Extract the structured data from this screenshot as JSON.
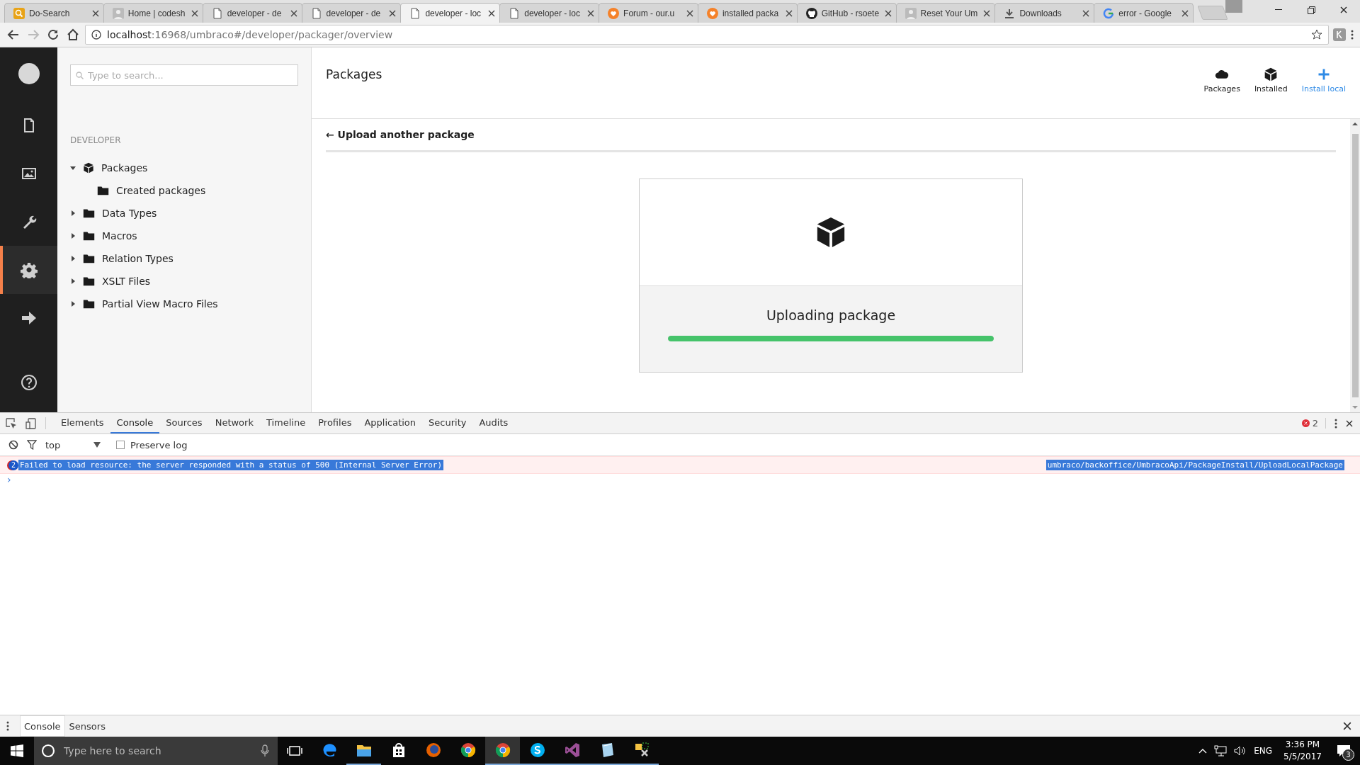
{
  "browser_tabs": [
    {
      "title": "Do-Search",
      "kind": "search",
      "selected": false
    },
    {
      "title": "Home | codesh",
      "kind": "avatar",
      "selected": false
    },
    {
      "title": "developer - de",
      "kind": "page",
      "selected": false
    },
    {
      "title": "developer - de",
      "kind": "page",
      "selected": false
    },
    {
      "title": "developer - loc",
      "kind": "page",
      "selected": true
    },
    {
      "title": "developer - loc",
      "kind": "page",
      "selected": false
    },
    {
      "title": "Forum - our.u",
      "kind": "heart",
      "selected": false
    },
    {
      "title": "installed packa",
      "kind": "heart",
      "selected": false
    },
    {
      "title": "GitHub - rsoete",
      "kind": "github",
      "selected": false
    },
    {
      "title": "Reset Your Um",
      "kind": "avatar",
      "selected": false
    },
    {
      "title": "Downloads",
      "kind": "download",
      "selected": false
    },
    {
      "title": "error - Google",
      "kind": "google",
      "selected": false
    }
  ],
  "address_bar": {
    "host": "localhost",
    "path": ":16968/umbraco#/developer/packager/overview"
  },
  "sections": [
    {
      "kind": "content",
      "selected": false
    },
    {
      "kind": "media",
      "selected": false
    },
    {
      "kind": "settings",
      "selected": false
    },
    {
      "kind": "developer",
      "selected": true
    },
    {
      "kind": "forms",
      "selected": false
    },
    {
      "kind": "help",
      "selected": false
    }
  ],
  "tree": {
    "search": {
      "placeholder": "Type to search..."
    },
    "heading": "DEVELOPER",
    "items": [
      {
        "label": "Packages",
        "kind": "package",
        "expanded": true,
        "children": [
          {
            "label": "Created packages",
            "kind": "folder"
          }
        ]
      },
      {
        "label": "Data Types",
        "kind": "folder",
        "expanded": false
      },
      {
        "label": "Macros",
        "kind": "folder",
        "expanded": false
      },
      {
        "label": "Relation Types",
        "kind": "folder",
        "expanded": false
      },
      {
        "label": "XSLT Files",
        "kind": "folder",
        "expanded": false
      },
      {
        "label": "Partial View Macro Files",
        "kind": "folder",
        "expanded": false
      }
    ]
  },
  "main": {
    "title": "Packages",
    "header_buttons": [
      {
        "label": "Packages",
        "kind": "cloud",
        "selected": false
      },
      {
        "label": "Installed",
        "kind": "package",
        "selected": false
      },
      {
        "label": "Install local",
        "kind": "plus",
        "selected": true
      }
    ],
    "back_link": "← Upload another package",
    "card": {
      "status": "Uploading package",
      "level": 1.0
    }
  },
  "devtools": {
    "tabs": [
      {
        "label": "Elements",
        "selected": false
      },
      {
        "label": "Console",
        "selected": true
      },
      {
        "label": "Sources",
        "selected": false
      },
      {
        "label": "Network",
        "selected": false
      },
      {
        "label": "Timeline",
        "selected": false
      },
      {
        "label": "Profiles",
        "selected": false
      },
      {
        "label": "Application",
        "selected": false
      },
      {
        "label": "Security",
        "selected": false
      },
      {
        "label": "Audits",
        "selected": false
      }
    ],
    "error_count": "2",
    "context": "top",
    "preserve_log": {
      "label": "Preserve log",
      "checked": false
    },
    "messages": [
      {
        "count": "2",
        "text": "Failed to load resource: the server responded with a status of 500 (Internal Server Error)",
        "source": "umbraco/backoffice/UmbracoApi/PackageInstall/UploadLocalPackage"
      }
    ],
    "prompt": "›",
    "drawer_tabs": [
      {
        "label": "Console",
        "selected": true
      },
      {
        "label": "Sensors",
        "selected": false
      }
    ]
  },
  "taskbar": {
    "search": {
      "placeholder": "Type here to search"
    },
    "apps": [
      {
        "kind": "edge",
        "running": false,
        "active": false
      },
      {
        "kind": "explorer",
        "running": true,
        "active": false
      },
      {
        "kind": "store",
        "running": false,
        "active": false
      },
      {
        "kind": "firefox",
        "running": false,
        "active": false
      },
      {
        "kind": "chrome",
        "running": false,
        "active": false
      },
      {
        "kind": "chrome",
        "running": true,
        "active": true
      },
      {
        "kind": "skype",
        "running": true,
        "active": false
      },
      {
        "kind": "studio",
        "running": true,
        "active": false
      },
      {
        "kind": "notepad",
        "running": true,
        "active": false
      },
      {
        "kind": "tool",
        "running": true,
        "active": false
      }
    ],
    "language": "ENG",
    "time": "3:36 PM",
    "date": "5/5/2017",
    "notifications": "3"
  }
}
